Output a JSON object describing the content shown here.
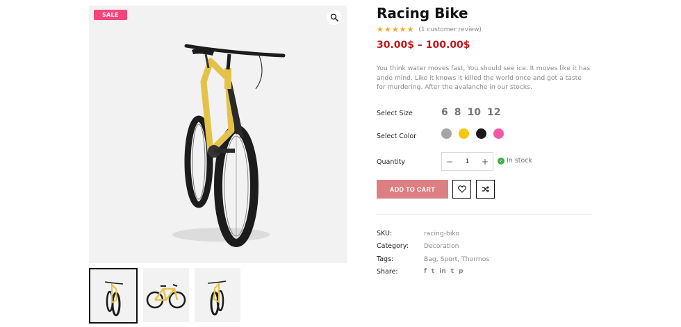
{
  "product": {
    "sale_badge": "SALE",
    "title": "Racing Bike",
    "stars": "★★★★★",
    "review_text": "(1 customer review)",
    "price": "30.00$ – 100.00$",
    "description": "You think water moves fast, You should see ice. It moves like it has ande mind. Like it knows it killed the world once and got a taste for murdering. After the avalanche in our stocks."
  },
  "options": {
    "size_label": "Select Size",
    "sizes": [
      "6",
      "8",
      "10",
      "12"
    ],
    "color_label": "Select Color",
    "colors": [
      "#a5a5a5",
      "#f2c90f",
      "#1b1b1b",
      "#f25aa8"
    ],
    "quantity_label": "Quantity",
    "quantity_value": "1",
    "minus": "−",
    "plus": "+",
    "stock_text": "In stock"
  },
  "actions": {
    "add_to_cart": "ADD TO CART"
  },
  "meta": {
    "sku_label": "SKU:",
    "sku_value": "racing-biko",
    "category_label": "Category:",
    "category_value": "Decoration",
    "tags_label": "Tags:",
    "tags_value": "Bag, Sport, Thormos",
    "share_label": "Share:",
    "share_icons": [
      "f",
      "t",
      "in",
      "t",
      "p"
    ]
  },
  "colors": {
    "accent_price": "#c0171c",
    "sale": "#f4467a",
    "cart_button": "#dc7f82",
    "stars": "#f5a623"
  }
}
